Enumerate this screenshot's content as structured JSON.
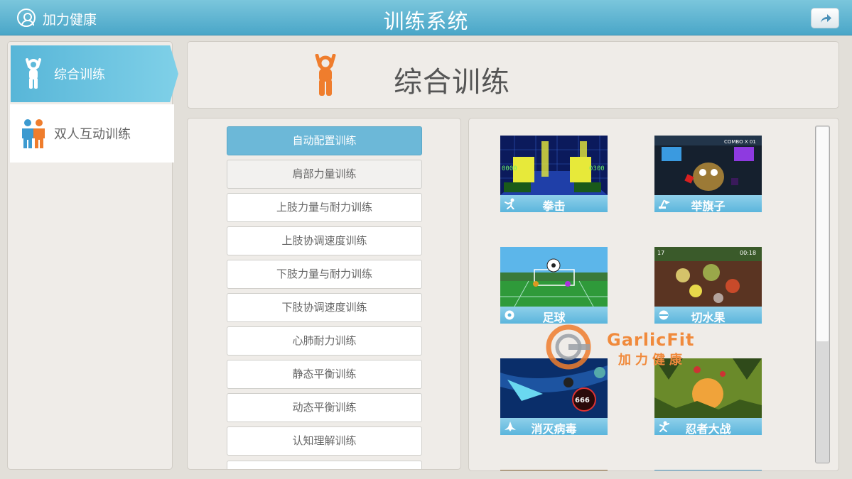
{
  "topbar": {
    "brand": "加力健康",
    "title": "训练系统"
  },
  "nav": {
    "items": [
      {
        "label": "综合训练",
        "icon": "person-arms-up-icon",
        "active": true
      },
      {
        "label": "双人互动训练",
        "icon": "two-people-icon",
        "active": false
      }
    ]
  },
  "header": {
    "title": "综合训练",
    "icon": "person-arms-up-icon"
  },
  "categories": [
    {
      "label": "自动配置训练",
      "state": "selected"
    },
    {
      "label": "肩部力量训练",
      "state": "hover"
    },
    {
      "label": "上肢力量与耐力训练",
      "state": "normal"
    },
    {
      "label": "上肢协调速度训练",
      "state": "normal"
    },
    {
      "label": "下肢力量与耐力训练",
      "state": "normal"
    },
    {
      "label": "下肢协调速度训练",
      "state": "normal"
    },
    {
      "label": "心肺耐力训练",
      "state": "normal"
    },
    {
      "label": "静态平衡训练",
      "state": "normal"
    },
    {
      "label": "动态平衡训练",
      "state": "normal"
    },
    {
      "label": "认知理解训练",
      "state": "normal"
    }
  ],
  "games": [
    {
      "label": "拳击",
      "icon": "punch-icon"
    },
    {
      "label": "举旗子",
      "icon": "flag-icon"
    },
    {
      "label": "足球",
      "icon": "soccer-ball-icon"
    },
    {
      "label": "切水果",
      "icon": "fruit-icon"
    },
    {
      "label": "消灭病毒",
      "icon": "spaceship-icon"
    },
    {
      "label": "忍者大战",
      "icon": "ninja-icon"
    }
  ],
  "game_screens": {
    "boxing": {
      "left_score": "0000",
      "right_score": "0300"
    },
    "flag": {
      "combo": "COMBO X 01"
    },
    "fruit": {
      "timer": "00:18",
      "score": "17"
    },
    "virus": {
      "score": "666"
    }
  },
  "watermark": {
    "line1": "GarlicFit",
    "line2": "加力健康"
  },
  "colors": {
    "topbar": "#4aa6c8",
    "accent": "#6cb8d8",
    "orange": "#ef7d2d"
  }
}
